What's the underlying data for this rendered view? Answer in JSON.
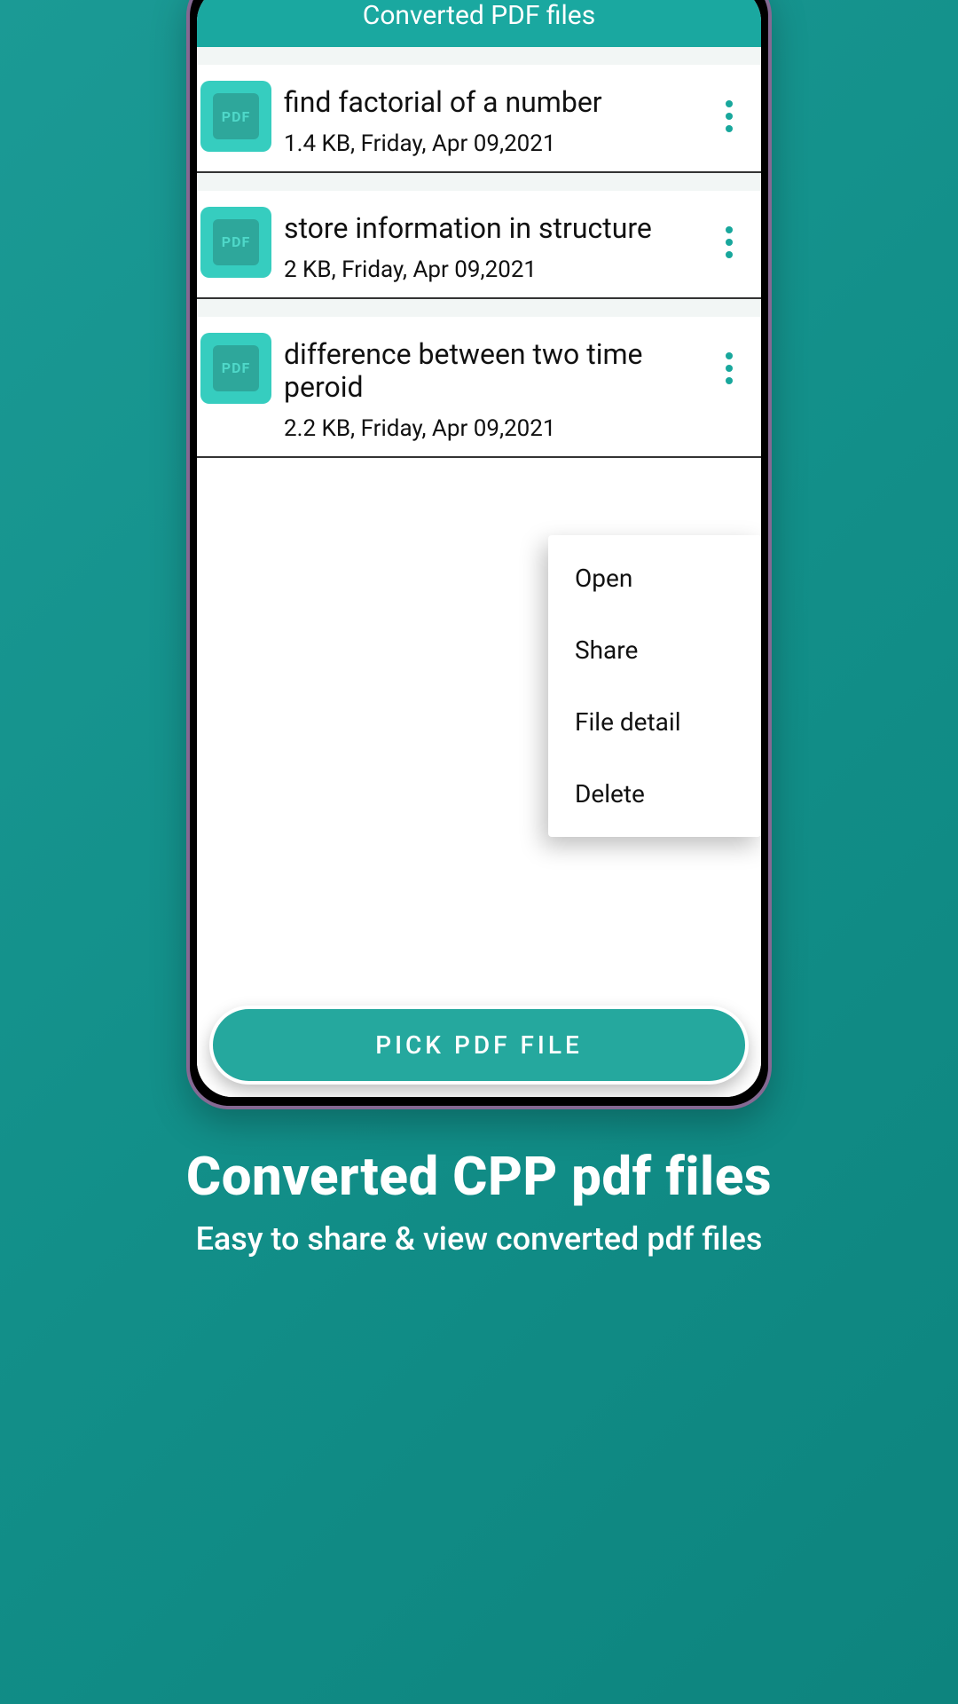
{
  "header": {
    "title": "Converted PDF files"
  },
  "icon_label": "PDF",
  "items": [
    {
      "title": "find factorial of a number",
      "sub": "1.4 KB, Friday, Apr 09,2021"
    },
    {
      "title": "store information in structure",
      "sub": "2 KB, Friday, Apr 09,2021"
    },
    {
      "title": "difference between two time peroid",
      "sub": "2.2 KB, Friday, Apr 09,2021"
    }
  ],
  "menu": {
    "open": "Open",
    "share": "Share",
    "detail": "File detail",
    "delete": "Delete"
  },
  "fab_label": "PICK PDF FILE",
  "promo": {
    "headline": "Converted CPP pdf files",
    "sub": "Easy to share & view converted pdf files"
  }
}
